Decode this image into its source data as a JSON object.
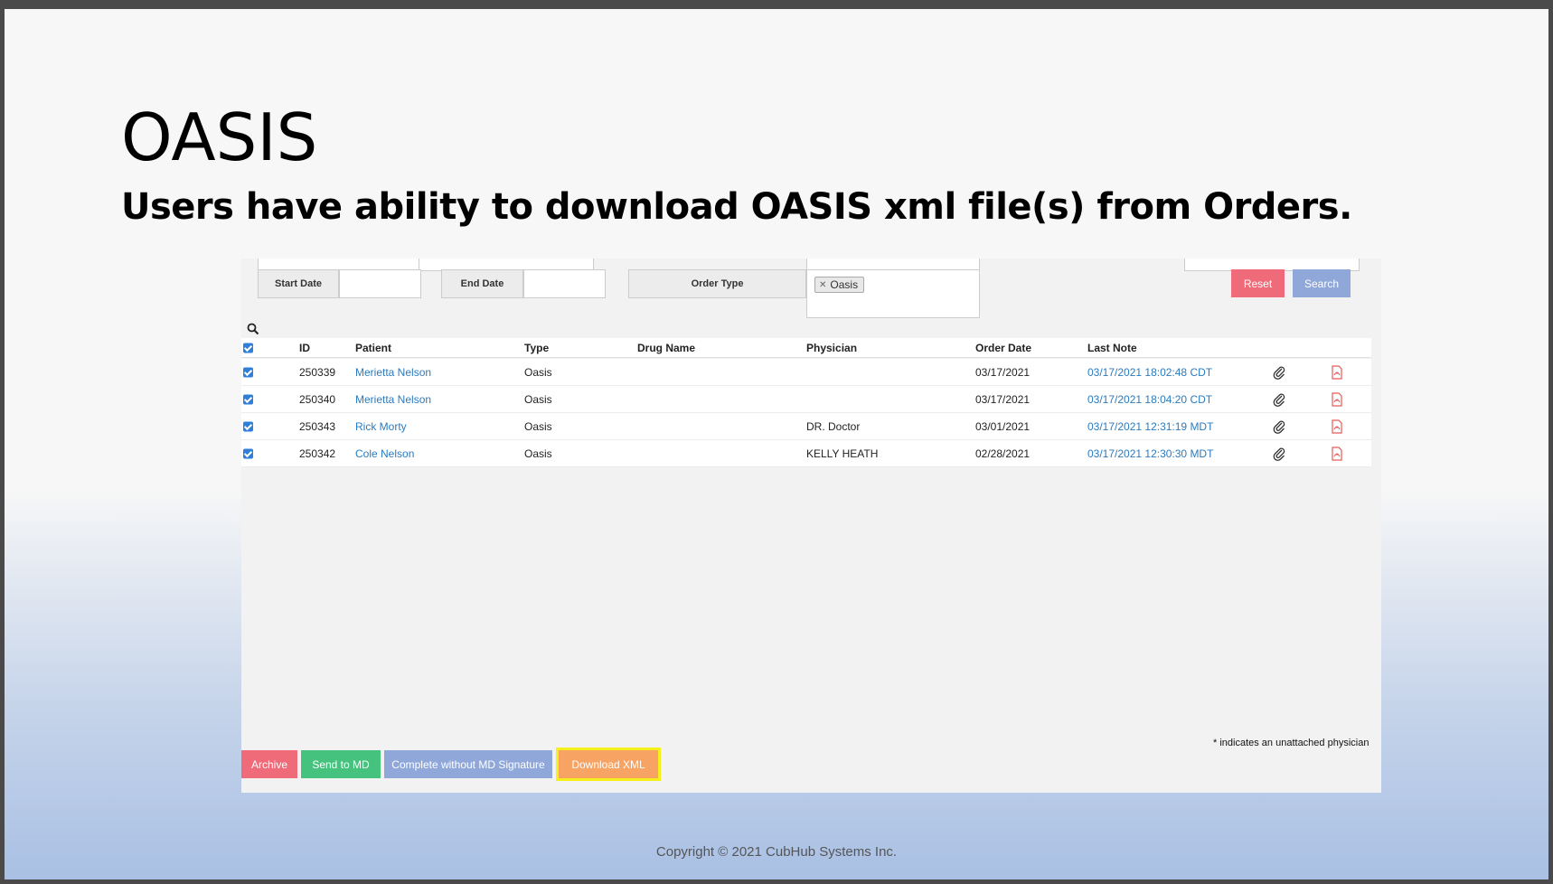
{
  "slide": {
    "title": "OASIS",
    "subtitle": "Users have ability to download OASIS xml  file(s) from Orders.",
    "copyright": "Copyright © 2021 CubHub Systems Inc."
  },
  "filters": {
    "start_date_label": "Start Date",
    "start_date_value": "",
    "end_date_label": "End Date",
    "end_date_value": "",
    "order_type_label": "Order Type",
    "order_type_tag": "Oasis",
    "reset_label": "Reset",
    "search_label": "Search"
  },
  "table": {
    "headers": {
      "id": "ID",
      "patient": "Patient",
      "type": "Type",
      "drug": "Drug Name",
      "physician": "Physician",
      "order_date": "Order Date",
      "last_note": "Last Note"
    },
    "rows": [
      {
        "id": "250339",
        "patient": "Merietta Nelson",
        "type": "Oasis",
        "drug": "",
        "physician": "",
        "order_date": "03/17/2021",
        "last_note": "03/17/2021 18:02:48 CDT"
      },
      {
        "id": "250340",
        "patient": "Merietta Nelson",
        "type": "Oasis",
        "drug": "",
        "physician": "",
        "order_date": "03/17/2021",
        "last_note": "03/17/2021 18:04:20 CDT"
      },
      {
        "id": "250343",
        "patient": "Rick Morty",
        "type": "Oasis",
        "drug": "",
        "physician": "DR. Doctor",
        "order_date": "03/01/2021",
        "last_note": "03/17/2021 12:31:19 MDT"
      },
      {
        "id": "250342",
        "patient": "Cole Nelson",
        "type": "Oasis",
        "drug": "",
        "physician": "KELLY HEATH",
        "order_date": "02/28/2021",
        "last_note": "03/17/2021 12:30:30 MDT"
      }
    ]
  },
  "footnote": "* indicates an unattached physician",
  "actions": {
    "archive": "Archive",
    "send_to_md": "Send to MD",
    "complete_without_signature": "Complete without MD Signature",
    "download_xml": "Download XML"
  },
  "colors": {
    "red": "#ef6b7a",
    "green": "#45c27d",
    "blue": "#8fa7d9",
    "orange": "#f7a363",
    "highlight": "#f5ef1c",
    "link": "#2a7bbf"
  }
}
